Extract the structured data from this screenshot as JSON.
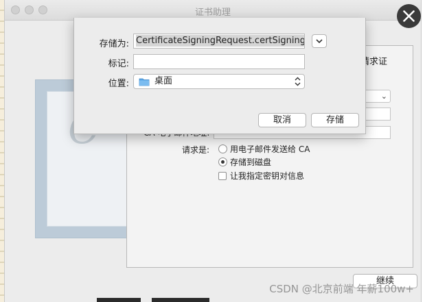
{
  "window": {
    "title": "证书助理"
  },
  "assistant_panel": {
    "heading_tail": "请求证",
    "partial_label": "CA 电子邮件地址:",
    "request_label": "请求是:",
    "options": {
      "email_ca": "用电子邮件发送给 CA",
      "save_to_disk": "存储到磁盘",
      "specify_key": "让我指定密钥对信息"
    },
    "selected_option": "save_to_disk",
    "continue_label": "继续"
  },
  "save_sheet": {
    "save_as_label": "存储为:",
    "save_as_value": "CertificateSigningRequest.certSigningRe",
    "tags_label": "标记:",
    "tags_value": "",
    "where_label": "位置:",
    "where_value": "桌面",
    "cancel_label": "取消",
    "save_label": "存储"
  },
  "watermark": "CSDN @北京前端 年薪100w+",
  "colors": {
    "overlay_close_bg": "#3a3a3a",
    "folder_blue": "#5aa7e8",
    "window_bg": "#ececec"
  },
  "icons": {
    "overlay_close": "close-icon",
    "expand": "chevron-down-icon",
    "folder": "folder-icon",
    "popup": "updown-chevron-icon"
  }
}
